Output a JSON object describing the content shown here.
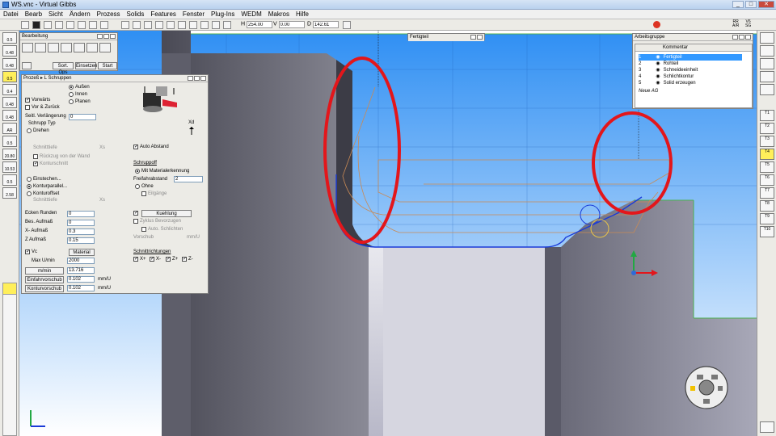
{
  "window": {
    "title": "WS.vnc - Virtual Gibbs"
  },
  "menu": [
    "Datei",
    "Bearb",
    "Sicht",
    "Ändern",
    "Prozess",
    "Solids",
    "Features",
    "Fenster",
    "Plug-Ins",
    "WEDM",
    "Makros",
    "Hilfe"
  ],
  "coords": {
    "h_label": "H",
    "h_value": "254.00",
    "v_label": "V",
    "v_value": "0.00",
    "d_label": "D",
    "d_value": "142.61"
  },
  "topright": {
    "label_r": "RR",
    "label_a": "A/R",
    "label_v": "V6",
    "label_s": "SG"
  },
  "left_tool_labels": [
    "0.5",
    "0.48",
    "0.48",
    "0.5",
    "0.4",
    "0.48",
    "0.48",
    "AR",
    "0.5",
    "20.80",
    "10.53",
    "0.5",
    "2.58"
  ],
  "bearbeitung": {
    "title": "Bearbeitung",
    "sort_label": "Sort. Ops",
    "insert_label": "Einsetzen",
    "start_label": "Start"
  },
  "schruppen": {
    "title": "Prozeß ▸ L Schruppen",
    "aussen": "Außen",
    "innen": "Innen",
    "planen": "Planen",
    "vorwaerts": "Vorwärts",
    "vor_zurueck": "Vor & Zurück",
    "seitl_label": "Seitl. Verlängerung",
    "seitl_value": "0",
    "schrupp_typ": "Schrupp Typ",
    "drehen": "Drehen",
    "schnitttiefe": "Schnitttiefe",
    "xs": "Xs",
    "rueckzug": "Rückzug von der Wand",
    "konturschnitt": "Konturschnitt",
    "einstechen": "Einstechen...",
    "konturparallel": "Konturparallel...",
    "konturoffset": "Konturoffset",
    "schnitttiefe2": "Schnitttiefe",
    "xs2": "Xs",
    "auto_abstand": "Auto Abstand",
    "schruppoff": "Schruppoff",
    "mit_materialerkennung": "Mit Materialerkennung",
    "freifahrabstand_label": "Freifahrabstand",
    "freifahrabstand_value": "2",
    "ohne": "Ohne",
    "eilgaenge": "Eilgänge",
    "xd": "Xd",
    "ecken_runden_label": "Ecken Runden",
    "ecken_runden_value": "0",
    "bes_aufmass_label": "Bes. Aufmaß",
    "bes_aufmass_value": "0",
    "x_aufmass_label": "X- Aufmaß",
    "x_aufmass_value": "0.3",
    "z_aufmass_label": "Z Aufmaß",
    "z_aufmass_value": "0.15",
    "vc_label": "Vc",
    "material_label": "Material",
    "max_umin_label": "Max U/min",
    "max_umin_value": "2000",
    "mmin_label": "m/min",
    "mmin_value": "13.716",
    "einfahrvorschub_label": "Einfahrvorschub",
    "einfahrvorschub_value": "0.102",
    "einfahr_unit": "mm/U",
    "konturvorschub_label": "Konturvorschub",
    "konturvorschub_value": "0.102",
    "kontur_unit": "mm/U",
    "kuehlung_label": "Kuehlung",
    "zyklus_label": "Zyklus Bevorzugen",
    "auto_schlichten_label": "Auto. Schlichten",
    "vorschub_label": "Vorschub",
    "vorschub_unit": "mm/U",
    "schnittrichtungen_label": "Schnittrichtungen",
    "dirs": [
      "X+",
      "X-",
      "Z+",
      "Z-"
    ]
  },
  "fertigteil": {
    "title": "Fertigteil"
  },
  "arbeitsgruppe": {
    "title": "Arbeitsgruppe",
    "header": "Kommentar",
    "rows": [
      {
        "num": "1",
        "name": "Fertigteil"
      },
      {
        "num": "2",
        "name": "Rohteil"
      },
      {
        "num": "3",
        "name": "Schneideeinheit"
      },
      {
        "num": "4",
        "name": "Schlichtkontur"
      },
      {
        "num": "5",
        "name": "Solid erzeugen"
      }
    ],
    "new_label": "Neue AG"
  },
  "right_tool_labels": [
    "T1",
    "T2",
    "T3",
    "T4",
    "T5",
    "T6",
    "T7",
    "T8",
    "T9",
    "T10"
  ],
  "colors": {
    "annotation_red": "#e3161b",
    "viewport_top": "#2f8ff3",
    "toolpath_blue": "#1a3bd8",
    "outline_green": "#4caf50"
  }
}
